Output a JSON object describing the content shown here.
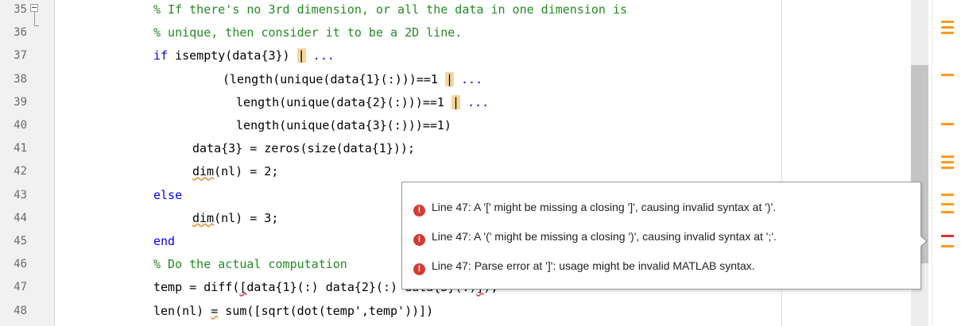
{
  "editor": {
    "lines": [
      {
        "num": "35",
        "segments": [
          {
            "t": "% If there's no 3rd dimension, or all the data in one dimension is",
            "c": "cm"
          }
        ]
      },
      {
        "num": "36",
        "segments": [
          {
            "t": "% unique, then consider it to be a 2D line.",
            "c": "cm"
          }
        ]
      },
      {
        "num": "37",
        "segments": [
          {
            "t": "if",
            "c": "kw"
          },
          {
            "t": " isempty(data{3}) ",
            "c": ""
          },
          {
            "t": "|",
            "c": "hl"
          },
          {
            "t": " ...",
            "c": "dots"
          }
        ]
      },
      {
        "num": "38",
        "segments": [
          {
            "t": "(length(unique(data{1}(:)))==1 ",
            "c": ""
          },
          {
            "t": "|",
            "c": "hl"
          },
          {
            "t": " ...",
            "c": "dots"
          }
        ]
      },
      {
        "num": "39",
        "segments": [
          {
            "t": " length(unique(data{2}(:)))==1 ",
            "c": ""
          },
          {
            "t": "|",
            "c": "hl"
          },
          {
            "t": " ...",
            "c": "dots"
          }
        ]
      },
      {
        "num": "40",
        "segments": [
          {
            "t": " length(unique(data{3}(:)))==1)",
            "c": ""
          }
        ]
      },
      {
        "num": "41",
        "segments": [
          {
            "t": "data{3} = zeros(size(data{1}));",
            "c": ""
          }
        ]
      },
      {
        "num": "42",
        "segments": [
          {
            "t": "dim",
            "c": "sq"
          },
          {
            "t": "(nl) = 2;",
            "c": ""
          }
        ]
      },
      {
        "num": "43",
        "segments": [
          {
            "t": "else",
            "c": "kw"
          }
        ]
      },
      {
        "num": "44",
        "segments": [
          {
            "t": "dim",
            "c": "sq"
          },
          {
            "t": "(nl) = 3;",
            "c": ""
          }
        ]
      },
      {
        "num": "45",
        "segments": [
          {
            "t": "end",
            "c": "kw"
          }
        ]
      },
      {
        "num": "46",
        "segments": [
          {
            "t": "% Do the actual computation",
            "c": "cm"
          }
        ]
      },
      {
        "num": "47",
        "segments": [
          {
            "t": "temp = diff(",
            "c": ""
          },
          {
            "t": "[",
            "c": "sqr"
          },
          {
            "t": "data{1}(:) data{2}(:) data{3}(:)",
            "c": ""
          },
          {
            "t": "]",
            "c": "sqr"
          },
          {
            "t": ");",
            "c": ""
          }
        ]
      },
      {
        "num": "48",
        "segments": [
          {
            "t": "len(nl) ",
            "c": ""
          },
          {
            "t": "=",
            "c": "sq"
          },
          {
            "t": " sum([sqrt(dot(temp',temp'))])",
            "c": ""
          }
        ]
      }
    ]
  },
  "tooltip": {
    "messages": [
      "Line 47: A '[' might be missing a closing ']', causing invalid syntax at ')'.",
      "Line 47: A '(' might be missing a closing ')', causing invalid syntax at ';'.",
      "Line 47: Parse error at ']': usage might be invalid MATLAB syntax."
    ],
    "icon": "error-icon",
    "error_color": "#d43b32"
  },
  "colors": {
    "comment": "#228b22",
    "keyword": "#0000ff",
    "warning_marker": "#ff9a1a",
    "error_marker": "#d33"
  }
}
